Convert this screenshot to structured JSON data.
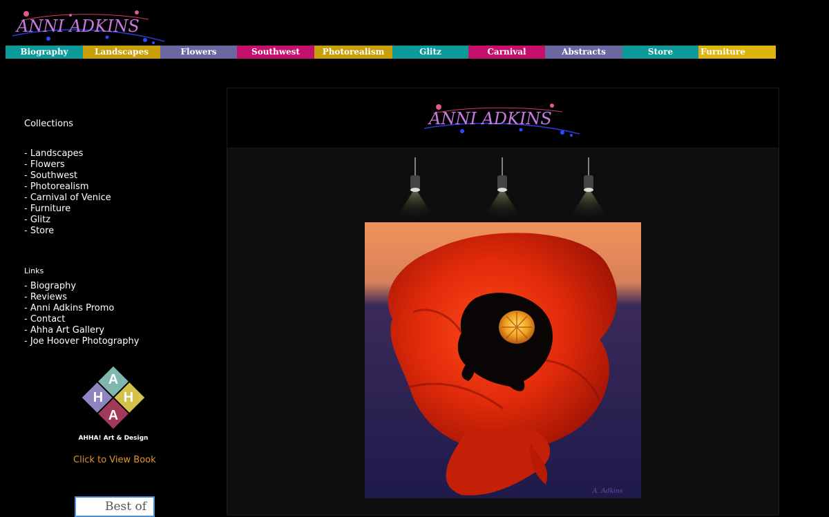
{
  "brand": {
    "logo_text": "ANNI ADKINS"
  },
  "nav": [
    {
      "label": "Biography",
      "color": "#0d9a9a"
    },
    {
      "label": "Landscapes",
      "color": "#c99f08"
    },
    {
      "label": "Flowers",
      "color": "#6a67a1"
    },
    {
      "label": "Southwest",
      "color": "#c4106a"
    },
    {
      "label": "Photorealism",
      "color": "#c99f08"
    },
    {
      "label": "Glitz",
      "color": "#0d9a9a"
    },
    {
      "label": "Carnival",
      "color": "#c4106a"
    },
    {
      "label": "Abstracts",
      "color": "#6a67a1"
    },
    {
      "label": "Store",
      "color": "#0d9a9a"
    },
    {
      "label": "Furniture",
      "color": "#dcb40c"
    }
  ],
  "sidebar": {
    "collections_heading": "Collections",
    "collections": [
      "- Landscapes",
      "- Flowers",
      "- Southwest",
      "- Photorealism",
      "- Carnival of Venice",
      "- Furniture",
      "- Glitz",
      "- Store"
    ],
    "links_heading": "Links",
    "links": [
      "- Biography",
      "- Reviews",
      "- Anni Adkins Promo",
      "- Contact",
      "- Ahha Art Gallery",
      "- Joe Hoover Photography"
    ],
    "ahha_caption": "AHHA! Art & Design",
    "view_book_label": "Click to View Book",
    "best_of_label": "Best of"
  },
  "main": {
    "logo_text": "ANNI ADKINS",
    "painting_subject": "red poppy painting"
  }
}
